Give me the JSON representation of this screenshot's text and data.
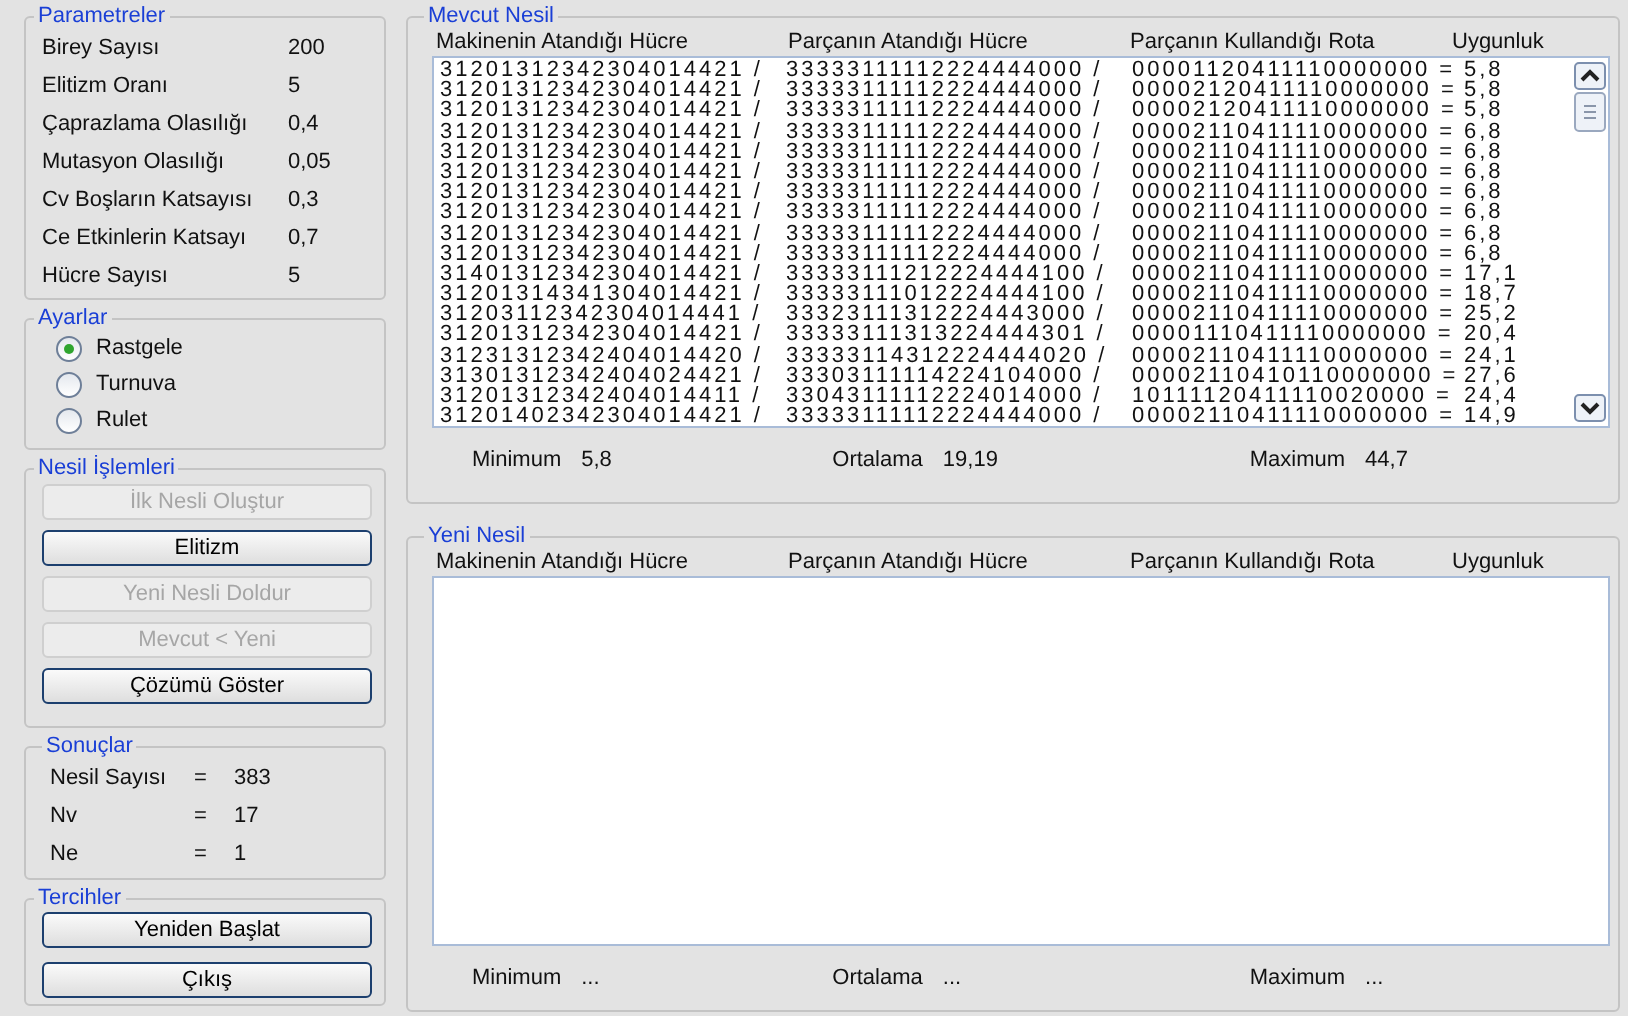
{
  "parameters": {
    "title": "Parametreler",
    "items": [
      {
        "label": "Birey Sayısı",
        "value": "200"
      },
      {
        "label": "Elitizm Oranı",
        "value": "5"
      },
      {
        "label": "Çaprazlama Olasılığı",
        "value": "0,4"
      },
      {
        "label": "Mutasyon Olasılığı",
        "value": "0,05"
      },
      {
        "label": "Cv Boşların Katsayısı",
        "value": "0,3"
      },
      {
        "label": "Ce Etkinlerin Katsayı",
        "value": "0,7"
      },
      {
        "label": "Hücre Sayısı",
        "value": "5"
      }
    ]
  },
  "settings": {
    "title": "Ayarlar",
    "options": [
      {
        "label": "Rastgele",
        "selected": true
      },
      {
        "label": "Turnuva",
        "selected": false
      },
      {
        "label": "Rulet",
        "selected": false
      }
    ]
  },
  "operations": {
    "title": "Nesil İşlemleri",
    "buttons": [
      {
        "label": "İlk Nesli Oluştur",
        "disabled": true
      },
      {
        "label": "Elitizm",
        "disabled": false
      },
      {
        "label": "Yeni Nesli Doldur",
        "disabled": true
      },
      {
        "label": "Mevcut < Yeni",
        "disabled": true
      },
      {
        "label": "Çözümü Göster",
        "disabled": false
      }
    ]
  },
  "results": {
    "title": "Sonuçlar",
    "rows": [
      {
        "label": "Nesil Sayısı",
        "sign": "=",
        "value": "383"
      },
      {
        "label": "Nv",
        "sign": "=",
        "value": "17"
      },
      {
        "label": "Ne",
        "sign": "=",
        "value": "1"
      }
    ]
  },
  "preferences": {
    "title": "Tercihler",
    "buttons": [
      {
        "label": "Yeniden Başlat",
        "disabled": false
      },
      {
        "label": "Çıkış",
        "disabled": false
      }
    ]
  },
  "current": {
    "title": "Mevcut Nesil",
    "columns": [
      "Makinenin Atandığı Hücre",
      "Parçanın Atandığı Hücre",
      "Parçanın Kullandığı Rota",
      "Uygunluk"
    ],
    "rows": [
      [
        "31201312342304014421 /",
        "33333111112224444000 /",
        "00001120411110000000 =",
        "5,8"
      ],
      [
        "31201312342304014421 /",
        "33333111112224444000 /",
        "00002120411110000000 =",
        "5,8"
      ],
      [
        "31201312342304014421 /",
        "33333111112224444000 /",
        "00002120411110000000 =",
        "5,8"
      ],
      [
        "31201312342304014421 /",
        "33333111112224444000 /",
        "00002110411110000000 =",
        "6,8"
      ],
      [
        "31201312342304014421 /",
        "33333111112224444000 /",
        "00002110411110000000 =",
        "6,8"
      ],
      [
        "31201312342304014421 /",
        "33333111112224444000 /",
        "00002110411110000000 =",
        "6,8"
      ],
      [
        "31201312342304014421 /",
        "33333111112224444000 /",
        "00002110411110000000 =",
        "6,8"
      ],
      [
        "31201312342304014421 /",
        "33333111112224444000 /",
        "00002110411110000000 =",
        "6,8"
      ],
      [
        "31201312342304014421 /",
        "33333111112224444000 /",
        "00002110411110000000 =",
        "6,8"
      ],
      [
        "31201312342304014421 /",
        "33333111112224444000 /",
        "00002110411110000000 =",
        "6,8"
      ],
      [
        "31401312342304014421 /",
        "33333111212224444100 /",
        "00002110411110000000 =",
        "17,1"
      ],
      [
        "31201314341304014421 /",
        "33333111012224444100 /",
        "00002110411110000000 =",
        "18,7"
      ],
      [
        "31203112342304014441 /",
        "33323111312224443000 /",
        "00002110411110000000 =",
        "25,2"
      ],
      [
        "31201312342304014421 /",
        "33333111313224444301 /",
        "00001110411110000000 =",
        "20,4"
      ],
      [
        "31231312342404014420 /",
        "33333114312224444020 /",
        "00002110411110000000 =",
        "24,1"
      ],
      [
        "31301312342404024421 /",
        "33303111114224104000 /",
        "00002110410110000000 =",
        "27,6"
      ],
      [
        "31201312342404014411 /",
        "33043111112224014000 /",
        "10111120411110020000 =",
        "24,4"
      ],
      [
        "31201402342304014421 /",
        "33333111112224444000 /",
        "00002110411110000000 =",
        "14,9"
      ]
    ],
    "stats": [
      {
        "label": "Minimum",
        "value": "5,8"
      },
      {
        "label": "Ortalama",
        "value": "19,19"
      },
      {
        "label": "Maximum",
        "value": "44,7"
      }
    ]
  },
  "next": {
    "title": "Yeni Nesil",
    "columns": [
      "Makinenin Atandığı Hücre",
      "Parçanın Atandığı Hücre",
      "Parçanın Kullandığı Rota",
      "Uygunluk"
    ],
    "stats": [
      {
        "label": "Minimum",
        "value": "..."
      },
      {
        "label": "Ortalama",
        "value": "..."
      },
      {
        "label": "Maximum",
        "value": "..."
      }
    ]
  }
}
